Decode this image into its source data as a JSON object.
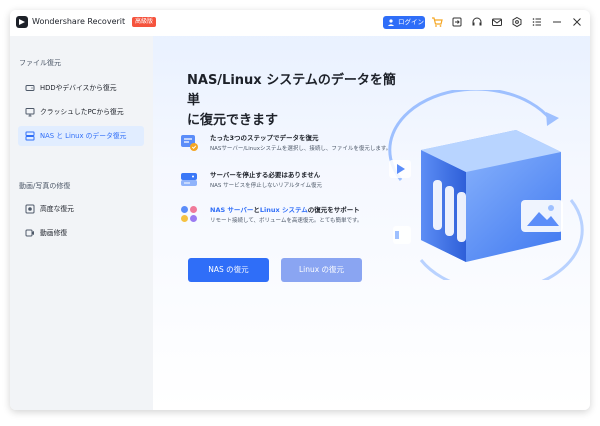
{
  "titlebar": {
    "app_name": "Wondershare Recoverit",
    "edition_badge": "高級版",
    "login_label": "ログイン",
    "icons": [
      "cart-icon",
      "sign-in-icon",
      "headset-icon",
      "mail-icon",
      "settings-hex-icon",
      "menu-icon",
      "minimize-icon",
      "close-icon"
    ]
  },
  "sidebar": {
    "section1_title": "ファイル復元",
    "items1": [
      {
        "label": "HDDやデバイスから復元",
        "icon": "hard-drive-icon"
      },
      {
        "label": "クラッシュしたPCから復元",
        "icon": "monitor-icon"
      },
      {
        "label": "NAS と Linux のデータ復元",
        "icon": "nas-icon",
        "active": true
      }
    ],
    "section2_title": "動画/写真の修復",
    "items2": [
      {
        "label": "高度な復元",
        "icon": "advanced-recovery-icon"
      },
      {
        "label": "動画修復",
        "icon": "video-repair-icon"
      }
    ]
  },
  "main": {
    "headline_line1": "NAS/Linux システムのデータを簡単",
    "headline_line2": "に復元できます",
    "features": [
      {
        "title": "たった3つのステップでデータを復元",
        "desc": "NASサーバー/Linuxシステムを選択し、接続し、ファイルを復元します。"
      },
      {
        "title": "サーバーを停止する必要はありません",
        "desc": "NAS サービスを停止しないリアルタイム復元"
      },
      {
        "title_part1": "NAS サーバー",
        "title_part2": "と",
        "title_part3": "Linux システム",
        "title_part4": "の復元をサポート",
        "desc": "リモート接続して、ボリュームを高速復元。とても簡単です。"
      }
    ],
    "nas_button": "NAS の復元",
    "linux_button": "Linux の復元"
  },
  "colors": {
    "accent": "#2f6ef8",
    "linux_button": "#8aa5f2",
    "sidebar_bg": "#f2f4f7",
    "active_item_bg": "#e1edff",
    "badge": "#f5533d",
    "cart": "#f5a623"
  }
}
